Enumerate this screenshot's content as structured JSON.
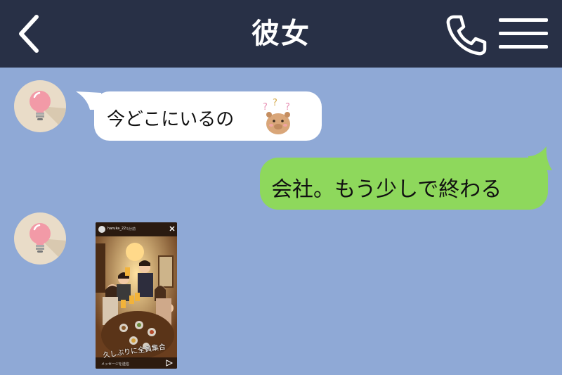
{
  "header": {
    "title": "彼女",
    "back_icon": "chevron-left-icon",
    "call_icon": "phone-icon",
    "menu_icon": "hamburger-menu-icon",
    "background": "#283046"
  },
  "chat": {
    "background": "#8fa9d6",
    "messages": [
      {
        "side": "left",
        "type": "text",
        "text": "今どこにいるの",
        "sticker": "confused-capybara-sticker"
      },
      {
        "side": "right",
        "type": "text",
        "text": "会社。もう少しで終わる",
        "bubble_color": "#8ed85c"
      },
      {
        "side": "left",
        "type": "image"
      }
    ]
  },
  "story": {
    "username": "haruka_22",
    "time": "5分前",
    "caption": "久しぶりに全員集合",
    "reply_placeholder": "メッセージを送信"
  },
  "avatar": {
    "icon": "lightbulb-icon",
    "bulb_color": "#f29aa7"
  }
}
